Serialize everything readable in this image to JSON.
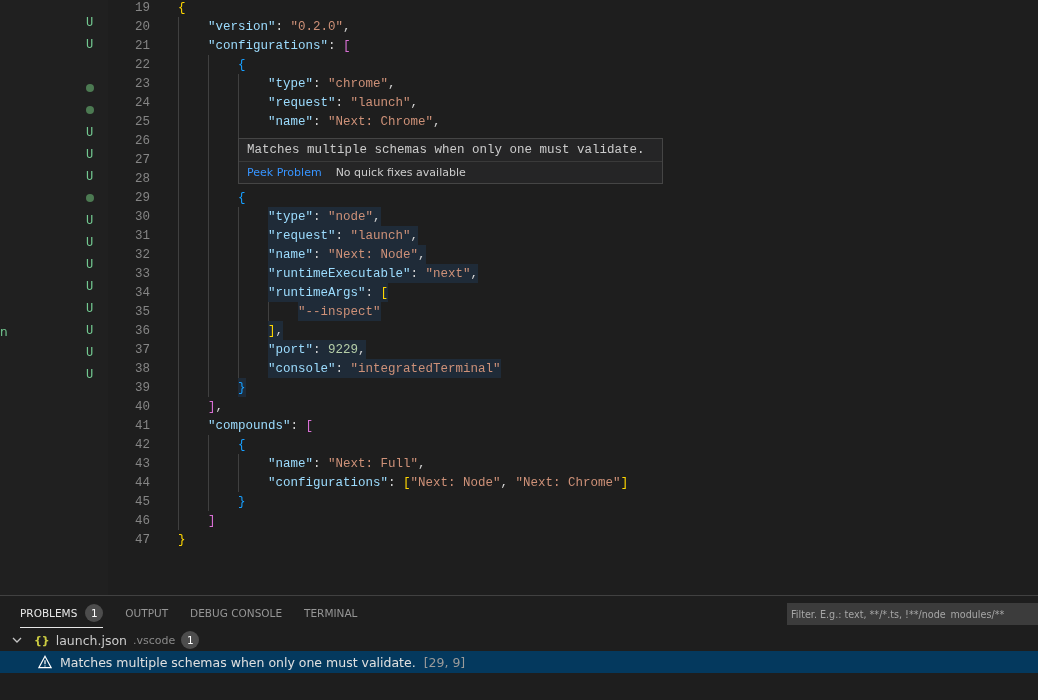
{
  "explorer": {
    "decorations": [
      {
        "kind": "none"
      },
      {
        "kind": "letter",
        "text": "U"
      },
      {
        "kind": "letter",
        "text": "U"
      },
      {
        "kind": "none"
      },
      {
        "kind": "dot"
      },
      {
        "kind": "dot"
      },
      {
        "kind": "letter",
        "text": "U"
      },
      {
        "kind": "letter",
        "text": "U"
      },
      {
        "kind": "letter",
        "text": "U"
      },
      {
        "kind": "dot"
      },
      {
        "kind": "letter",
        "text": "U"
      },
      {
        "kind": "letter",
        "text": "U"
      },
      {
        "kind": "letter",
        "text": "U"
      },
      {
        "kind": "letter",
        "text": "U"
      },
      {
        "kind": "letter",
        "text": "U"
      },
      {
        "kind": "letter",
        "text": "U",
        "name": "n"
      },
      {
        "kind": "letter",
        "text": "U"
      },
      {
        "kind": "letter",
        "text": "U"
      }
    ]
  },
  "editor": {
    "lines": [
      {
        "number": "19",
        "selected": false,
        "tokens": [
          {
            "kind": "b1",
            "text": "{"
          }
        ],
        "children": [
          {
            "number": "20",
            "selected": false,
            "tokens": [
              {
                "kind": "key",
                "text": "\"version\""
              },
              {
                "kind": "p",
                "text": ": "
              },
              {
                "kind": "str",
                "text": "\"0.2.0\""
              },
              {
                "kind": "p",
                "text": ","
              }
            ]
          },
          {
            "number": "21",
            "selected": false,
            "tokens": [
              {
                "kind": "key",
                "text": "\"configurations\""
              },
              {
                "kind": "p",
                "text": ": "
              },
              {
                "kind": "b2",
                "text": "["
              }
            ],
            "children": [
              {
                "number": "22",
                "selected": false,
                "tokens": [
                  {
                    "kind": "b3",
                    "text": "{"
                  }
                ],
                "children": [
                  {
                    "number": "23",
                    "selected": false,
                    "tokens": [
                      {
                        "kind": "key",
                        "text": "\"type\""
                      },
                      {
                        "kind": "p",
                        "text": ": "
                      },
                      {
                        "kind": "str",
                        "text": "\"chrome\""
                      },
                      {
                        "kind": "p",
                        "text": ","
                      }
                    ]
                  },
                  {
                    "number": "24",
                    "selected": false,
                    "tokens": [
                      {
                        "kind": "key",
                        "text": "\"request\""
                      },
                      {
                        "kind": "p",
                        "text": ": "
                      },
                      {
                        "kind": "str",
                        "text": "\"launch\""
                      },
                      {
                        "kind": "p",
                        "text": ","
                      }
                    ]
                  },
                  {
                    "number": "25",
                    "selected": false,
                    "tokens": [
                      {
                        "kind": "key",
                        "text": "\"name\""
                      },
                      {
                        "kind": "p",
                        "text": ": "
                      },
                      {
                        "kind": "str",
                        "text": "\"Next: Chrome\""
                      },
                      {
                        "kind": "p",
                        "text": ","
                      }
                    ]
                  },
                  {
                    "number": "26",
                    "selected": false
                  }
                ]
              },
              {
                "number": "27",
                "selected": false
              },
              {
                "number": "28",
                "selected": false
              },
              {
                "number": "29",
                "selected": false,
                "tokens": [
                  {
                    "kind": "b3",
                    "text": "{"
                  }
                ],
                "children": [
                  {
                    "number": "30",
                    "selected": true,
                    "tokens": [
                      {
                        "kind": "key",
                        "text": "\"type\""
                      },
                      {
                        "kind": "p",
                        "text": ": "
                      },
                      {
                        "kind": "str",
                        "text": "\"node\""
                      },
                      {
                        "kind": "p",
                        "text": ","
                      }
                    ]
                  },
                  {
                    "number": "31",
                    "selected": true,
                    "tokens": [
                      {
                        "kind": "key",
                        "text": "\"request\""
                      },
                      {
                        "kind": "p",
                        "text": ": "
                      },
                      {
                        "kind": "str",
                        "text": "\"launch\""
                      },
                      {
                        "kind": "p",
                        "text": ","
                      }
                    ]
                  },
                  {
                    "number": "32",
                    "selected": true,
                    "tokens": [
                      {
                        "kind": "key",
                        "text": "\"name\""
                      },
                      {
                        "kind": "p",
                        "text": ": "
                      },
                      {
                        "kind": "str",
                        "text": "\"Next: Node\""
                      },
                      {
                        "kind": "p",
                        "text": ","
                      }
                    ]
                  },
                  {
                    "number": "33",
                    "selected": true,
                    "tokens": [
                      {
                        "kind": "key",
                        "text": "\"runtimeExecutable\""
                      },
                      {
                        "kind": "p",
                        "text": ": "
                      },
                      {
                        "kind": "str",
                        "text": "\"next\""
                      },
                      {
                        "kind": "p",
                        "text": ","
                      }
                    ]
                  },
                  {
                    "number": "34",
                    "selected": true,
                    "tokens": [
                      {
                        "kind": "key",
                        "text": "\"runtimeArgs\""
                      },
                      {
                        "kind": "p",
                        "text": ": "
                      },
                      {
                        "kind": "b1",
                        "text": "["
                      }
                    ],
                    "children": [
                      {
                        "number": "35",
                        "selected": true,
                        "tokens": [
                          {
                            "kind": "str",
                            "text": "\"--inspect\""
                          }
                        ]
                      }
                    ]
                  },
                  {
                    "number": "36",
                    "selected": true,
                    "tokens": [
                      {
                        "kind": "b1",
                        "text": "]"
                      },
                      {
                        "kind": "p",
                        "text": ","
                      }
                    ]
                  },
                  {
                    "number": "37",
                    "selected": true,
                    "tokens": [
                      {
                        "kind": "key",
                        "text": "\"port\""
                      },
                      {
                        "kind": "p",
                        "text": ": "
                      },
                      {
                        "kind": "num",
                        "text": "9229"
                      },
                      {
                        "kind": "p",
                        "text": ","
                      }
                    ]
                  },
                  {
                    "number": "38",
                    "selected": true,
                    "tokens": [
                      {
                        "kind": "key",
                        "text": "\"console\""
                      },
                      {
                        "kind": "p",
                        "text": ": "
                      },
                      {
                        "kind": "str",
                        "text": "\"integratedTerminal\""
                      }
                    ]
                  }
                ]
              },
              {
                "number": "39",
                "selected": true,
                "tokens": [
                  {
                    "kind": "b3",
                    "text": "}"
                  }
                ]
              }
            ]
          },
          {
            "number": "40",
            "selected": false,
            "tokens": [
              {
                "kind": "b2",
                "text": "]"
              },
              {
                "kind": "p",
                "text": ","
              }
            ]
          },
          {
            "number": "41",
            "selected": false,
            "tokens": [
              {
                "kind": "key",
                "text": "\"compounds\""
              },
              {
                "kind": "p",
                "text": ": "
              },
              {
                "kind": "b2",
                "text": "["
              }
            ],
            "children": [
              {
                "number": "42",
                "selected": false,
                "tokens": [
                  {
                    "kind": "b3",
                    "text": "{"
                  }
                ],
                "children": [
                  {
                    "number": "43",
                    "selected": false,
                    "tokens": [
                      {
                        "kind": "key",
                        "text": "\"name\""
                      },
                      {
                        "kind": "p",
                        "text": ": "
                      },
                      {
                        "kind": "str",
                        "text": "\"Next: Full\""
                      },
                      {
                        "kind": "p",
                        "text": ","
                      }
                    ]
                  },
                  {
                    "number": "44",
                    "selected": false,
                    "tokens": [
                      {
                        "kind": "key",
                        "text": "\"configurations\""
                      },
                      {
                        "kind": "p",
                        "text": ": "
                      },
                      {
                        "kind": "b1",
                        "text": "["
                      },
                      {
                        "kind": "str",
                        "text": "\"Next: Node\""
                      },
                      {
                        "kind": "p",
                        "text": ", "
                      },
                      {
                        "kind": "str",
                        "text": "\"Next: Chrome\""
                      },
                      {
                        "kind": "b1",
                        "text": "]"
                      }
                    ]
                  }
                ]
              },
              {
                "number": "45",
                "selected": false,
                "tokens": [
                  {
                    "kind": "b3",
                    "text": "}"
                  }
                ]
              }
            ]
          },
          {
            "number": "46",
            "selected": false,
            "tokens": [
              {
                "kind": "b2",
                "text": "]"
              }
            ]
          }
        ]
      },
      {
        "number": "47",
        "selected": false,
        "tokens": [
          {
            "kind": "b1",
            "text": "}"
          }
        ]
      }
    ]
  },
  "hover": {
    "message": "Matches multiple schemas when only one must validate.",
    "action": "Peek Problem",
    "note": "No quick fixes available"
  },
  "panel": {
    "tabs": [
      {
        "label": "PROBLEMS",
        "badge": "1",
        "selected": true
      },
      {
        "label": "OUTPUT",
        "selected": false
      },
      {
        "label": "DEBUG CONSOLE",
        "selected": false
      },
      {
        "label": "TERMINAL",
        "selected": false
      }
    ],
    "filter": {
      "placeholder": "Filter. E.g.: text, **/*.ts, !**/node_modules/**"
    },
    "file": {
      "expanded": true,
      "icon": "{}",
      "name": "launch.json",
      "folder": ".vscode",
      "count": "1"
    },
    "problems": [
      {
        "message": "Matches multiple schemas when only one must validate.",
        "location": "[29, 9]",
        "selected": true
      }
    ]
  }
}
